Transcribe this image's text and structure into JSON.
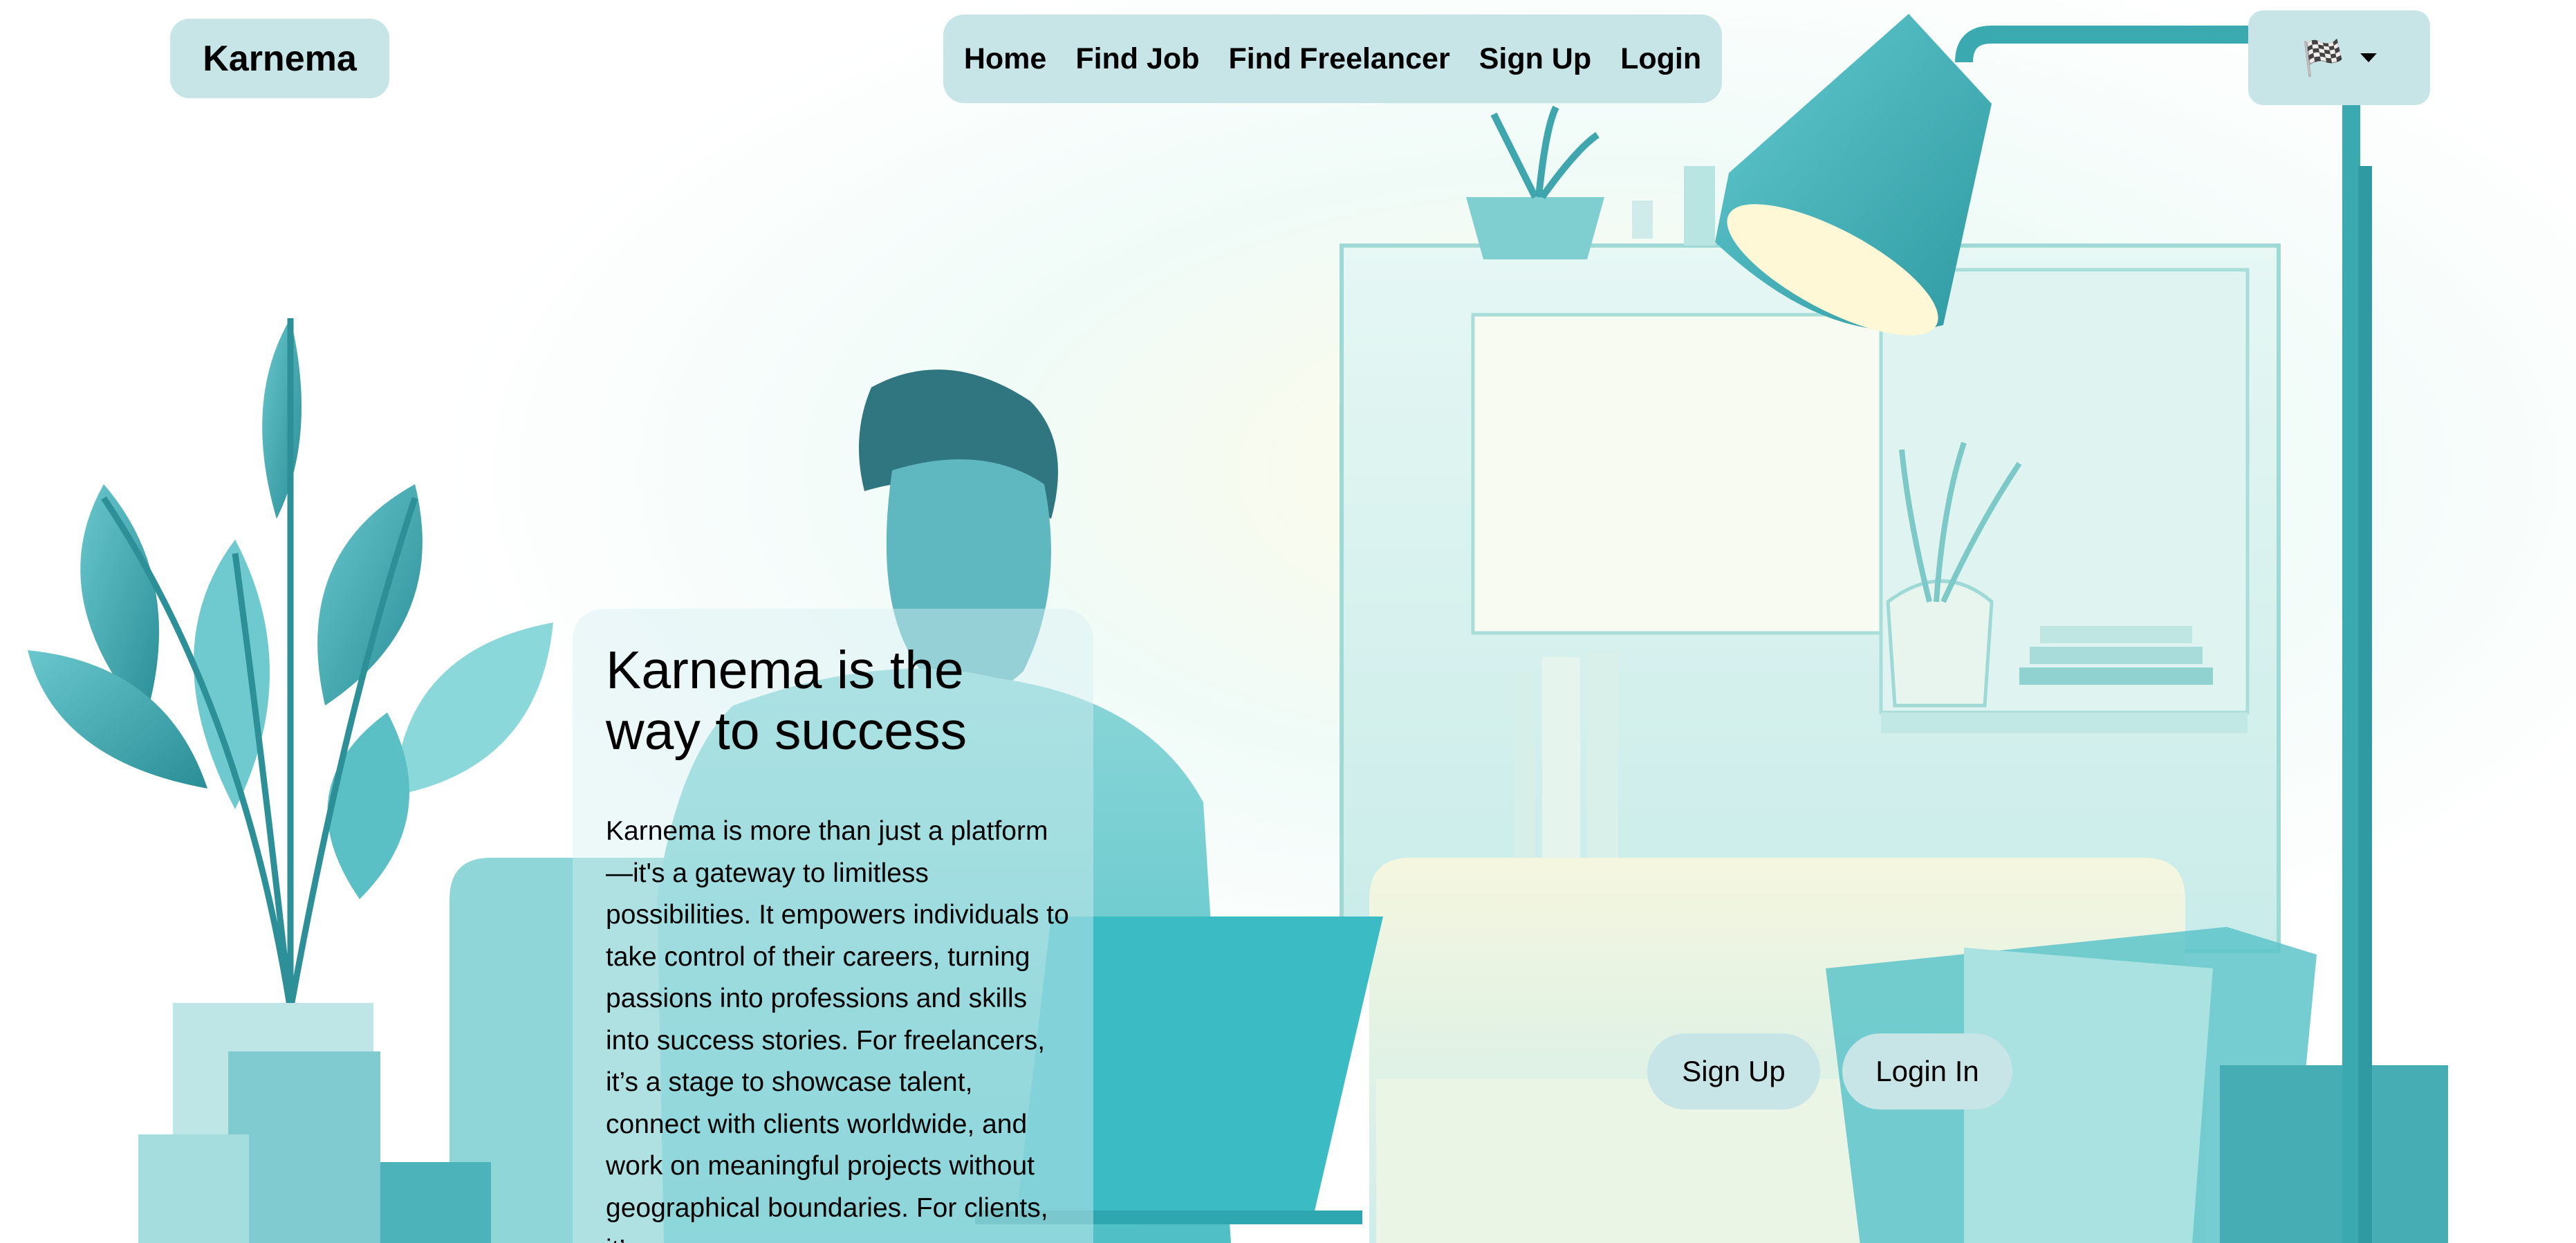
{
  "brand": {
    "name": "Karnema"
  },
  "nav": {
    "items": [
      {
        "label": "Home"
      },
      {
        "label": "Find Job"
      },
      {
        "label": "Find Freelancer"
      },
      {
        "label": "Sign Up"
      },
      {
        "label": "Login"
      }
    ]
  },
  "language": {
    "icon": "flag-icon",
    "glyph": "🏁"
  },
  "hero": {
    "title": "Karnema is the way to success",
    "description": "Karnema is more than just a platform—it's a gateway to limitless possibilities. It empowers individuals to take control of their careers, turning passions into professions and skills into success stories. For freelancers, it’s a stage to showcase talent, connect with clients worldwide, and work on meaningful projects without geographical boundaries. For clients, it’s a"
  },
  "cta": {
    "signup_label": "Sign Up",
    "login_label": "Login In"
  },
  "colors": {
    "pill_bg": "#c7e4e6",
    "accent_teal": "#3ab7bf",
    "text": "#000000"
  }
}
